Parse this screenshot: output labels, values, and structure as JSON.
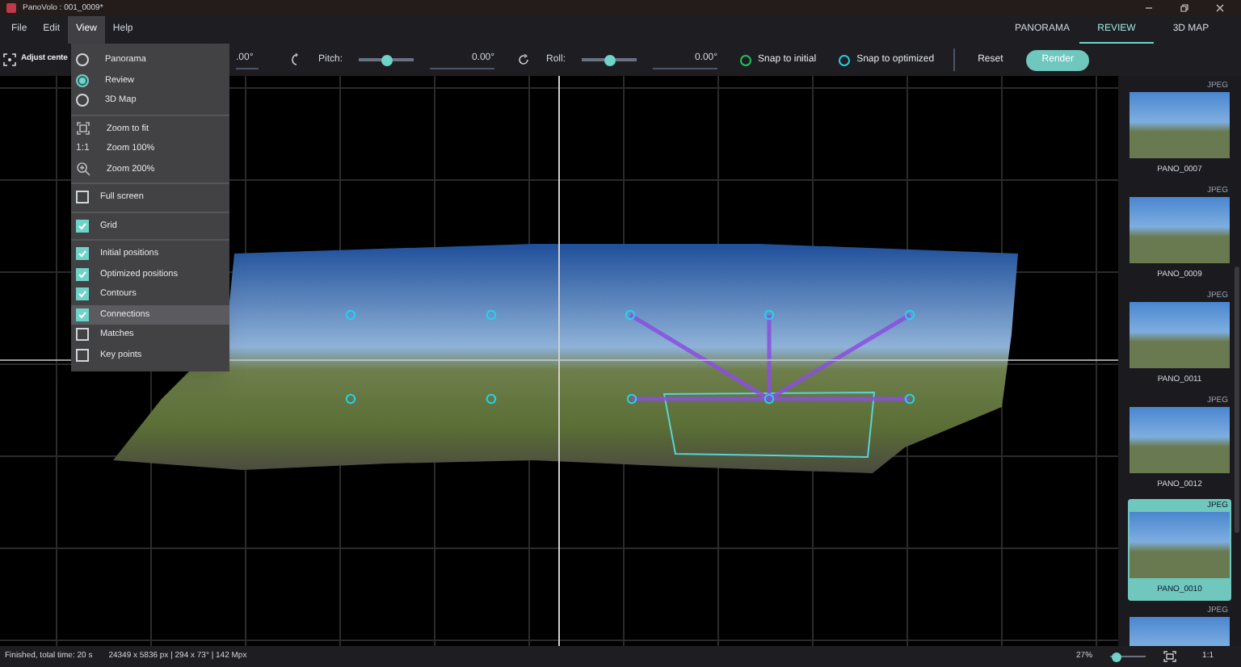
{
  "window": {
    "title": "PanoVolo : 001_0009*"
  },
  "menu_bar": [
    {
      "label": "File",
      "selected": false
    },
    {
      "label": "Edit",
      "selected": false
    },
    {
      "label": "View",
      "selected": true
    },
    {
      "label": "Help",
      "selected": false
    }
  ],
  "tabs": [
    {
      "label": "PANORAMA",
      "selected": false
    },
    {
      "label": "REVIEW",
      "selected": true
    },
    {
      "label": "3D MAP",
      "selected": false
    }
  ],
  "toolbar": {
    "adjust_label": "Adjust cente",
    "yaw_value": ".00°",
    "sliders": [
      {
        "label": "Pitch:",
        "level": 0.5,
        "value": "0.00°"
      },
      {
        "label": "Roll:",
        "level": 0.5,
        "value": "0.00°"
      }
    ],
    "snaps": [
      {
        "label": "Snap to initial",
        "color": "#22c55e"
      },
      {
        "label": "Snap to optimized",
        "color": "#22d3ee"
      }
    ],
    "buttons": [
      {
        "label": "Reset",
        "kind": "plain"
      },
      {
        "label": "Render",
        "kind": "primary"
      }
    ]
  },
  "view_menu": {
    "sections": [
      {
        "items": [
          {
            "kind": "radio",
            "label": "Panorama",
            "selected": false
          },
          {
            "kind": "radio",
            "label": "Review",
            "selected": true
          },
          {
            "kind": "radio",
            "label": "3D Map",
            "selected": false
          }
        ]
      },
      {
        "items": [
          {
            "kind": "zoom-fit",
            "label": "Zoom to fit"
          },
          {
            "kind": "glyph",
            "glyph": "1:1",
            "label": "Zoom 100%"
          },
          {
            "kind": "zoom-in",
            "label": "Zoom 200%"
          }
        ]
      },
      {
        "items": [
          {
            "kind": "check",
            "label": "Full screen",
            "checked": false,
            "hovered": false
          }
        ]
      },
      {
        "items": [
          {
            "kind": "check",
            "label": "Grid",
            "checked": true,
            "hovered": false
          }
        ]
      },
      {
        "items": [
          {
            "kind": "check",
            "label": "Initial positions",
            "checked": true,
            "hovered": false
          },
          {
            "kind": "check",
            "label": "Optimized positions",
            "checked": true,
            "hovered": false
          },
          {
            "kind": "check",
            "label": "Contours",
            "checked": true,
            "hovered": false
          },
          {
            "kind": "check",
            "label": "Connections",
            "checked": true,
            "hovered": true
          },
          {
            "kind": "check",
            "label": "Matches",
            "checked": false,
            "hovered": false
          },
          {
            "kind": "check",
            "label": "Key points",
            "checked": false,
            "hovered": false
          }
        ]
      }
    ]
  },
  "thumbnails": [
    {
      "format": "JPEG",
      "name": "PANO_0007",
      "selected": false
    },
    {
      "format": "JPEG",
      "name": "PANO_0009",
      "selected": false
    },
    {
      "format": "JPEG",
      "name": "PANO_0011",
      "selected": false
    },
    {
      "format": "JPEG",
      "name": "PANO_0012",
      "selected": false
    },
    {
      "format": "JPEG",
      "name": "PANO_0010",
      "selected": true
    },
    {
      "format": "JPEG",
      "selected": false
    }
  ],
  "status_bar": {
    "message": "Finished, total time: 20 s",
    "info": "24349 x 5836 px | 294 x 73° | 142 Mpx",
    "zoom": "27%",
    "zoom_slider": {
      "level": 0.1
    },
    "actual_size": "1:1"
  }
}
